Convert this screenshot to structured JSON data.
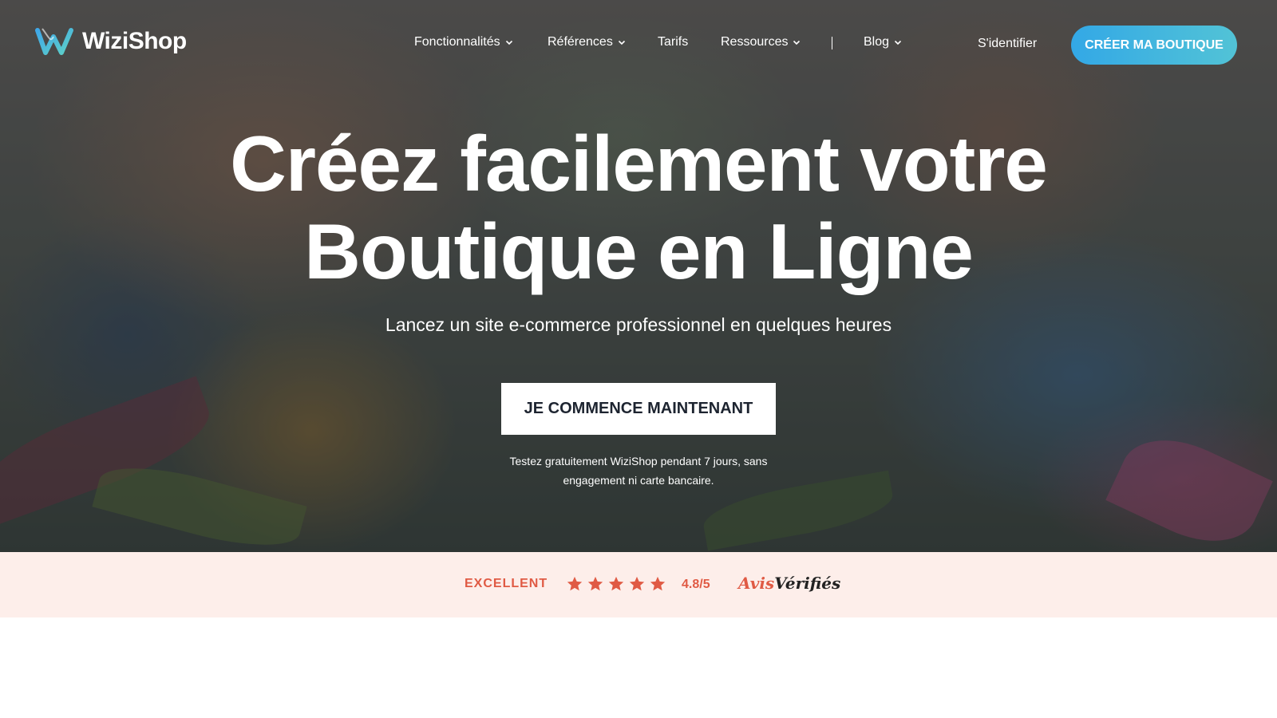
{
  "header": {
    "logo_text": "WiziShop",
    "nav": [
      {
        "label": "Fonctionnalités",
        "has_dropdown": true
      },
      {
        "label": "Références",
        "has_dropdown": true
      },
      {
        "label": "Tarifs",
        "has_dropdown": false
      },
      {
        "label": "Ressources",
        "has_dropdown": true
      },
      {
        "label": "Blog",
        "has_dropdown": true
      }
    ],
    "login_label": "S'identifier",
    "cta_label": "CRÉER MA BOUTIQUE"
  },
  "hero": {
    "title_line1": "Créez facilement votre",
    "title_line2": "Boutique en Ligne",
    "subtitle": "Lancez un site e-commerce professionnel en quelques heures",
    "cta_label": "JE COMMENCE MAINTENANT",
    "trial_line1": "Testez gratuitement WiziShop pendant 7 jours, sans",
    "trial_line2": "engagement ni carte bancaire."
  },
  "rating": {
    "label": "EXCELLENT",
    "stars": 5,
    "score": "4.8/5",
    "brand_part1": "Avis",
    "brand_part2": "Vérifiés"
  },
  "colors": {
    "accent_gradient_start": "#33a8e6",
    "accent_gradient_end": "#52c3d6",
    "rating_accent": "#e05a44",
    "rating_bg": "#fdeeea"
  },
  "icons": [
    "wizishop-logo-icon",
    "chevron-down-icon",
    "star-icon"
  ]
}
